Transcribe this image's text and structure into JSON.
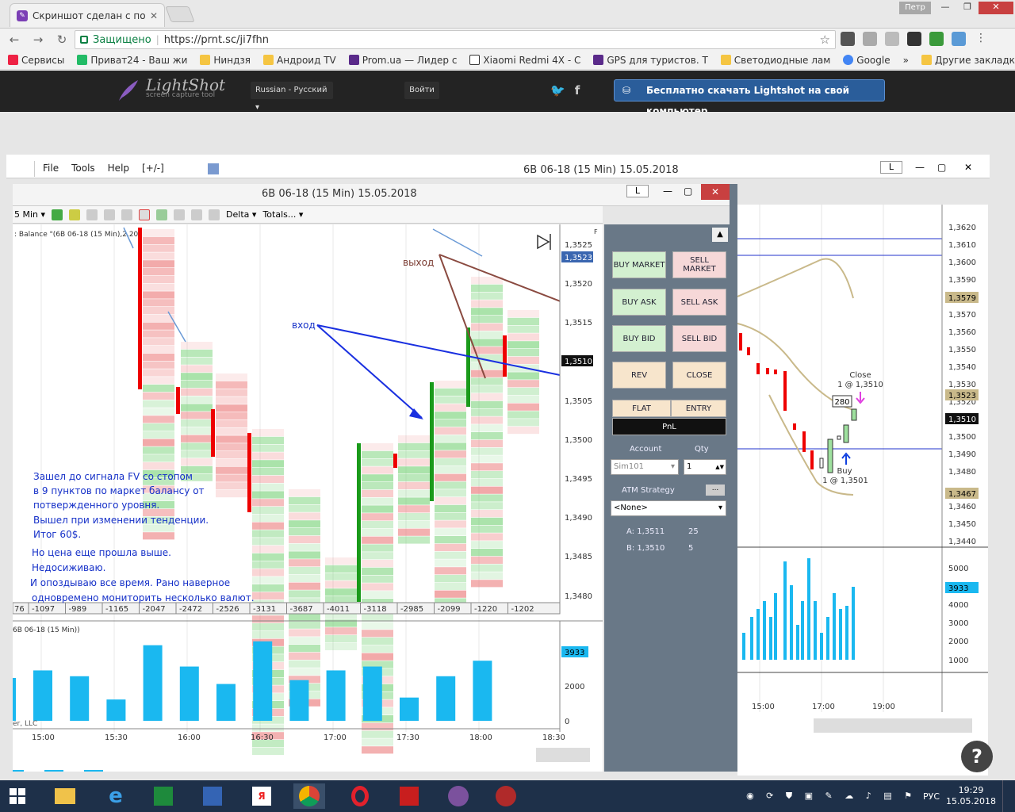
{
  "browser": {
    "tab_title": "Скриншот сделан с пом",
    "user": "Петр",
    "secure_label": "Защищено",
    "url": "https://prnt.sc/ji7fhn",
    "bookmarks": [
      "Сервисы",
      "Приват24 - Ваш жи",
      "Ниндзя",
      "Андроид TV",
      "Prom.ua — Лидер с",
      "Xiaomi Redmi 4X - С",
      "GPS для туристов. Т",
      "Светодиодные лам",
      "Google",
      "Другие закладки"
    ]
  },
  "lightshot": {
    "logo": "LightShot",
    "subtitle": "screen capture tool",
    "language": "Russian - Русский",
    "login": "Войти",
    "download": "Бесплатно скачать Lightshot на свой компьютер"
  },
  "back_window": {
    "menu": [
      "File",
      "Tools",
      "Help",
      "[+/-]"
    ],
    "caption": "6B 06-18 (15 Min)  15.05.2018",
    "price_ticks": [
      "1,3620",
      "1,3610",
      "1,3600",
      "1,3590",
      "1,3570",
      "1,3560",
      "1,3550",
      "1,3540",
      "1,3530",
      "1,3520",
      "1,3500",
      "1,3490",
      "1,3480",
      "1,3460",
      "1,3450",
      "1,3440"
    ],
    "badges": [
      "1,3579",
      "1,3523",
      "1,3510",
      "1,3467"
    ],
    "volume_ticks": [
      "5000",
      "4000",
      "3000",
      "2000",
      "1000",
      "0"
    ],
    "volume_badge": "3933",
    "time_ticks": [
      "15:00",
      "17:00",
      "19:00"
    ],
    "annotations": {
      "close": "Close",
      "close_detail": "1 @ 1,3510",
      "qty": "280",
      "buy": "Buy",
      "buy_detail": "1 @ 1,3501"
    }
  },
  "front_window": {
    "caption": "6B 06-18 (15 Min)  15.05.2018",
    "toolbar": {
      "interval": "5 Min",
      "delta": "Delta",
      "totals": "Totals..."
    },
    "indicator_label": ": Balance  \"(6B 06-18 (15 Min),2,20)",
    "price_ticks": [
      "1,3525",
      "1,3520",
      "1,3515",
      "1,3505",
      "1,3500",
      "1,3495",
      "1,3490",
      "1,3485",
      "1,3480"
    ],
    "price_badge_top": "1,3523",
    "price_badge_mid": "1,3510",
    "totals_row": [
      "76",
      "-1097",
      "-989",
      "-1165",
      "-2047",
      "-2472",
      "-2526",
      "-3131",
      "-3687",
      "-4011",
      "-3118",
      "-2985",
      "-2099",
      "-1220",
      "-1202"
    ],
    "volume_label": "6B 06-18 (15 Min))",
    "volume_ticks": [
      "2000",
      "0"
    ],
    "volume_badge": "3933",
    "time_ticks": [
      "15:00",
      "15:30",
      "16:00",
      "16:30",
      "17:00",
      "17:30",
      "18:00",
      "18:30"
    ],
    "footer_left": "er, LLC",
    "vyhod": "выход",
    "vhod": "вход",
    "note_lines": [
      "Зашел до сигнала  FV со стопом",
      "в 9 пунктов по маркет балансу от",
      "потвержденного уровня.",
      "Вышел при изменении тенденции.",
      "Итог 60$.",
      "Но цена еще прошла выше.",
      "Недосиживаю.",
      "И опоздываю все время. Рано наверное",
      "одновремено мониторить несколько валют."
    ]
  },
  "order_panel": {
    "buy_market": "BUY MARKET",
    "sell_market": "SELL MARKET",
    "buy_ask": "BUY ASK",
    "sell_ask": "SELL ASK",
    "buy_bid": "BUY BID",
    "sell_bid": "SELL BID",
    "rev": "REV",
    "close": "CLOSE",
    "flat": "FLAT",
    "entry": "ENTRY",
    "pnl": "PnL",
    "account_label": "Account",
    "qty_label": "Qty",
    "account_value": "Sim101",
    "qty_value": "1",
    "atm_label": "ATM Strategy",
    "atm_value": "<None>",
    "ask": "A: 1,3511",
    "ask_size": "25",
    "bid": "B: 1,3510",
    "bid_size": "5"
  },
  "taskbar": {
    "lang": "РУС",
    "time": "19:29",
    "date": "15.05.2018"
  },
  "chart_data": {
    "type": "bar",
    "title": "",
    "categories": [
      "15:00",
      "15:15",
      "15:30",
      "15:45",
      "16:00",
      "16:15",
      "16:30",
      "16:45",
      "17:00",
      "17:15",
      "17:30",
      "17:45",
      "18:00"
    ],
    "values": [
      2600,
      2300,
      1100,
      3900,
      2800,
      1900,
      4100,
      2100,
      2600,
      2800,
      1200,
      2300,
      3100
    ],
    "ylim": [
      0,
      4500
    ]
  }
}
